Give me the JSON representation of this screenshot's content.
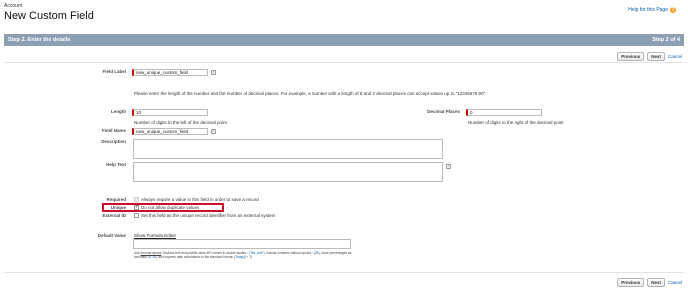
{
  "header": {
    "breadcrumb": "Account",
    "title": "New Custom Field",
    "help_link": "Help for this Page",
    "help_icon": "question-icon"
  },
  "step_bar": {
    "title": "Step 2. Enter the details",
    "step_count": "Step 2 of 4"
  },
  "buttons": {
    "previous": "Previous",
    "next": "Next",
    "cancel": "Cancel"
  },
  "form": {
    "field_label": {
      "label": "Field Label",
      "value": "new_unique_custom_field"
    },
    "instructions": "Please enter the length of the number and the number of decimal places. For example, a number with a length of 8 and 2 decimal places can accept values up to \"12345678.90\".",
    "length": {
      "label": "Length",
      "value": "10",
      "help": "Number of digits to the left of the decimal point"
    },
    "decimal_places": {
      "label": "Decimal Places",
      "value": "0",
      "help": "Number of digits to the right of the decimal point"
    },
    "field_name": {
      "label": "Field Name",
      "value": "new_unique_custom_field"
    },
    "description": {
      "label": "Description",
      "value": ""
    },
    "help_text": {
      "label": "Help Text",
      "value": ""
    },
    "required": {
      "label": "Required",
      "text": "Always require a value in this field in order to save a record",
      "checked": false
    },
    "unique": {
      "label": "Unique",
      "text": "Do not allow duplicate values",
      "checked": true
    },
    "external_id": {
      "label": "External ID",
      "text": "Set this field as the unique record identifier from an external system",
      "checked": false
    },
    "default_value": {
      "label": "Default Value",
      "formula_link": "Show Formula Editor",
      "value": ""
    },
    "formula_help": {
      "part1": "Use ",
      "syntax": "formula syntax",
      "part2": ": Enclose text and picklist value API names in double quotes : (",
      "kw1": "\"the_text\"",
      "part3": "), include numbers without quotes : (",
      "kw2": "25",
      "part4": "), show percentages as decimals: (",
      "kw3": "0.10",
      "part5": "), and express date calculations in the standard format: (",
      "kw4": "Today() + 7",
      "part6": ")"
    }
  }
}
